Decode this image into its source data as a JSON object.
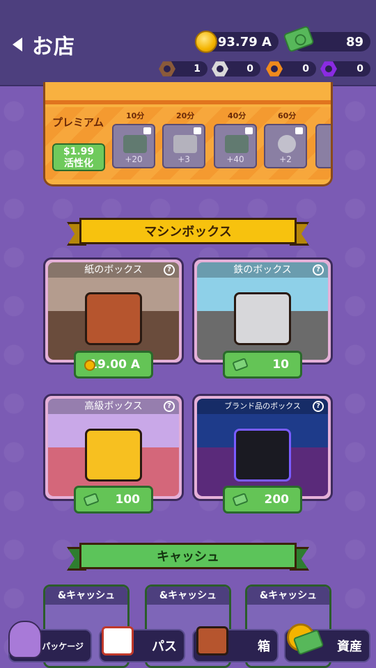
{
  "header": {
    "title": "お店",
    "coins": "893.79 A",
    "cash": "89",
    "nuts": [
      {
        "color": "#8a5a3a",
        "value": "1"
      },
      {
        "color": "#d9d9d9",
        "value": "0"
      },
      {
        "color": "#f08a1c",
        "value": "0"
      },
      {
        "color": "#8a2be2",
        "value": "0"
      }
    ]
  },
  "premium": {
    "label": "プレミアム",
    "price": "$1.99",
    "activate": "活性化",
    "tiers": [
      {
        "time": "10分",
        "amount": "+20"
      },
      {
        "time": "20分",
        "amount": "+3"
      },
      {
        "time": "40分",
        "amount": "+40"
      },
      {
        "time": "60分",
        "amount": "+2"
      }
    ]
  },
  "machine_section": {
    "title": "マシンボックス"
  },
  "boxes": [
    {
      "name": "紙のボックス",
      "price": "19.00 A",
      "currency": "coin"
    },
    {
      "name": "鉄のボックス",
      "price": "10",
      "currency": "cash"
    },
    {
      "name": "高級ボックス",
      "price": "100",
      "currency": "cash"
    },
    {
      "name": "ブランド品のボックス",
      "price": "200",
      "currency": "cash"
    }
  ],
  "help_glyph": "?",
  "cash_section": {
    "title": "キャッシュ"
  },
  "cash_cards": [
    {
      "title": "&キャッシュ"
    },
    {
      "title": "&キャッシュ"
    },
    {
      "title": "&キャッシュ"
    }
  ],
  "nav": {
    "package": "パッケージ",
    "pass": "パス",
    "box": "箱",
    "assets": "資産"
  },
  "colors": {
    "header": "#4d3f7e",
    "background": "#7b5bb4",
    "green_button": "#64c456",
    "ribbon_gold": "#f7c20e",
    "ribbon_green": "#5cc45a"
  }
}
